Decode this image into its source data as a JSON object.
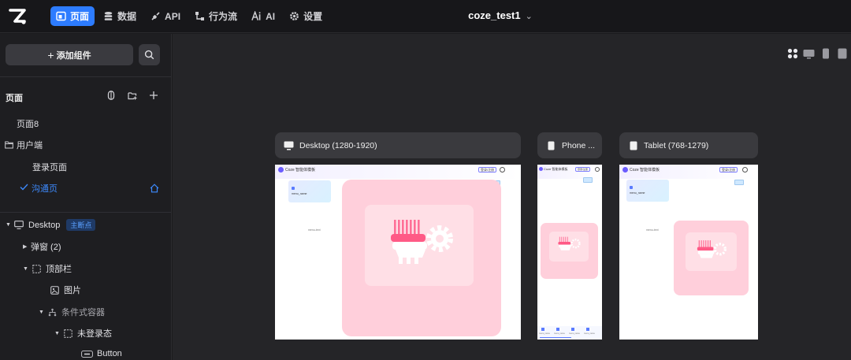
{
  "app": {
    "project_name": "coze_test1",
    "nav": [
      {
        "label": "页面",
        "icon": "page-icon"
      },
      {
        "label": "数据",
        "icon": "database-icon"
      },
      {
        "label": "API",
        "icon": "api-icon"
      },
      {
        "label": "行为流",
        "icon": "flow-icon"
      },
      {
        "label": "AI",
        "icon": "ai-icon"
      },
      {
        "label": "设置",
        "icon": "gear-icon"
      }
    ],
    "accent": "#2d7cff"
  },
  "sidebar": {
    "add_widget_label": "添加组件",
    "pages_title": "页面",
    "pages": [
      {
        "label": "页面8"
      },
      {
        "label": "用户端"
      },
      {
        "label": "登录页面"
      },
      {
        "label": "沟通页"
      }
    ],
    "tree": [
      {
        "label": "Desktop",
        "badge": "主断点"
      },
      {
        "label": "弹窗 (2)"
      },
      {
        "label": "顶部栏"
      },
      {
        "label": "图片"
      },
      {
        "label": "条件式容器"
      },
      {
        "label": "未登录态"
      },
      {
        "label": "Button"
      }
    ]
  },
  "canvas": {
    "frames": [
      {
        "label": "Desktop (1280-1920)",
        "icon": "desktop-icon"
      },
      {
        "label": "Phone ...",
        "icon": "phone-icon"
      },
      {
        "label": "Tablet (768-1279)",
        "icon": "tablet-icon"
      }
    ],
    "preview": {
      "site_title": "Coze 智能体模板",
      "site_title_short": "Coze 智能体模板",
      "login_button": "登录/注册",
      "card_label": "menu_name",
      "placeholder_text": "menu-text",
      "tab_labels": [
        "menu_name",
        "menu_name",
        "menu_name",
        "menu_name"
      ]
    }
  }
}
